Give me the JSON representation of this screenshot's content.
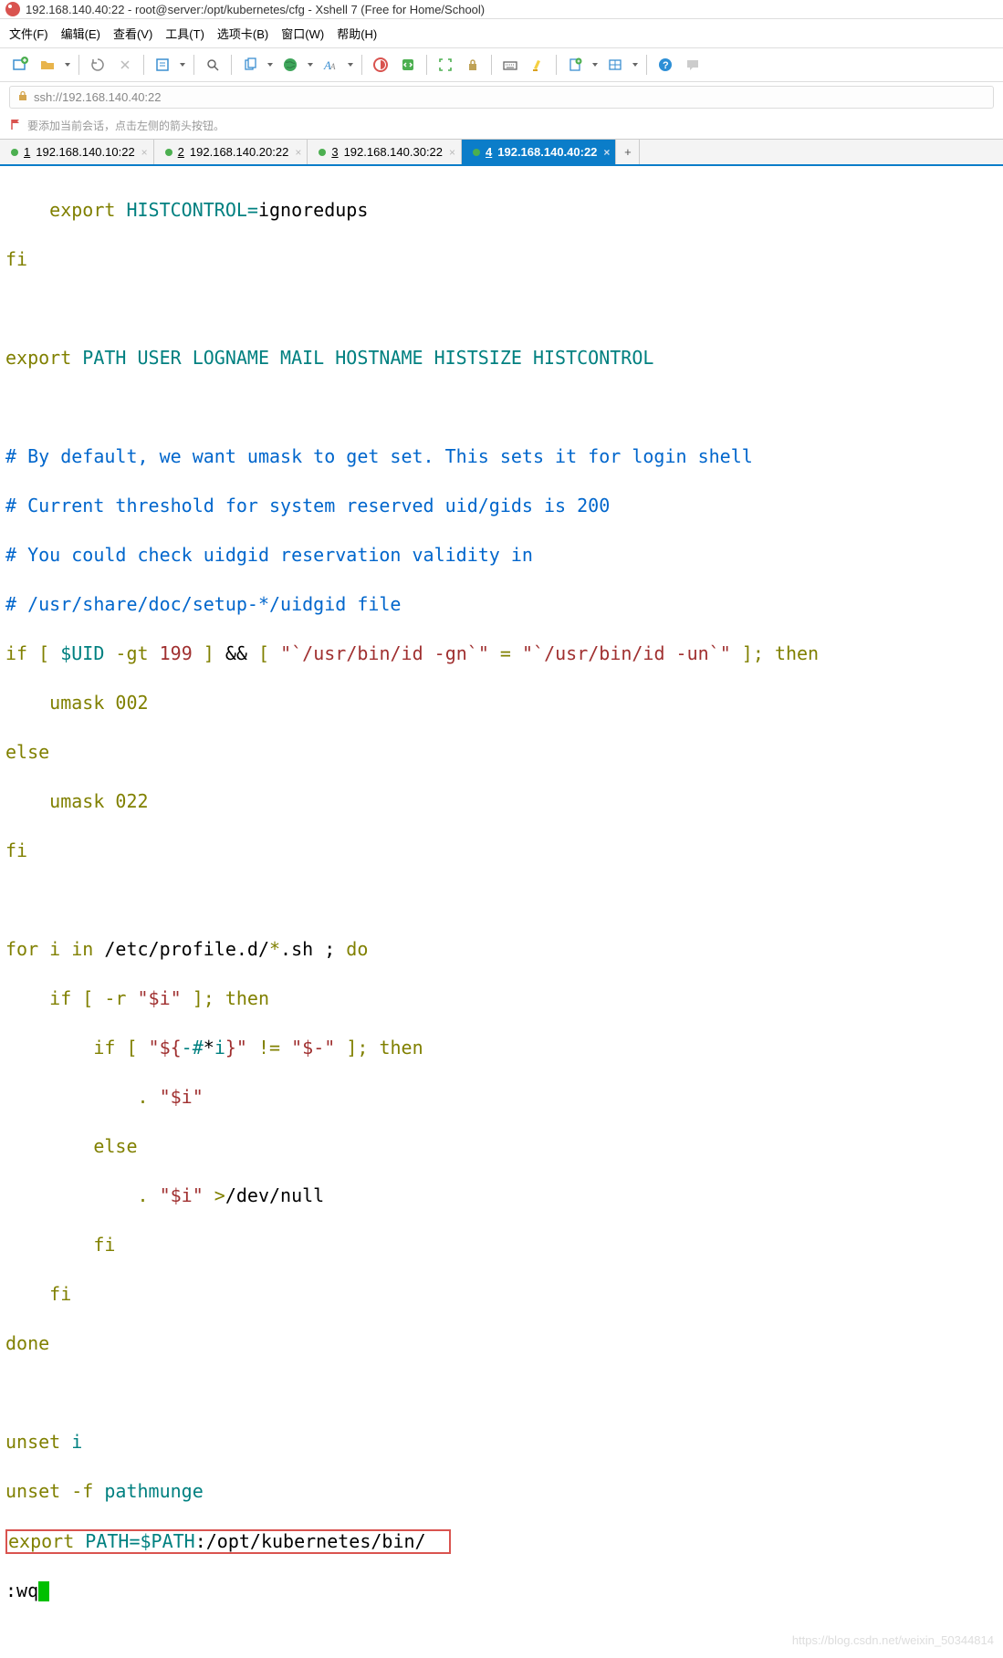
{
  "title": "192.168.140.40:22 - root@server:/opt/kubernetes/cfg - Xshell 7 (Free for Home/School)",
  "menu": {
    "file": "文件(F)",
    "edit": "编辑(E)",
    "view": "查看(V)",
    "tools": "工具(T)",
    "tab": "选项卡(B)",
    "window": "窗口(W)",
    "help": "帮助(H)"
  },
  "address": "ssh://192.168.140.40:22",
  "info_hint": "要添加当前会话，点击左侧的箭头按钮。",
  "tabs": [
    {
      "num": "1",
      "label": "192.168.140.10:22",
      "active": false
    },
    {
      "num": "2",
      "label": "192.168.140.20:22",
      "active": false
    },
    {
      "num": "3",
      "label": "192.168.140.30:22",
      "active": false
    },
    {
      "num": "4",
      "label": "192.168.140.40:22",
      "active": true
    }
  ],
  "term": {
    "l1a": "    export",
    "l1b": " HISTCONTROL=",
    "l1c": "ignoredups",
    "l2": "fi",
    "l4a": "export",
    "l4b": " PATH USER LOGNAME MAIL HOSTNAME HISTSIZE HISTCONTROL",
    "l6": "# By default, we want umask to get set. This sets it for login shell",
    "l7": "# Current threshold for system reserved uid/gids is 200",
    "l8": "# You could check uidgid reservation validity in",
    "l9": "# /usr/share/doc/setup-*/uidgid file",
    "l10a": "if",
    "l10b": " [ ",
    "l10c": "$UID",
    "l10d": " -gt ",
    "l10e": "199",
    "l10f": " ] ",
    "l10g": "&&",
    "l10h": " [ ",
    "l10i": "\"`/usr/bin/id -gn`\"",
    "l10j": " = ",
    "l10k": "\"`/usr/bin/id -un`\"",
    "l10l": " ]; ",
    "l10m": "then",
    "l11": "    umask 002",
    "l12": "else",
    "l13": "    umask 022",
    "l14": "fi",
    "l16a": "for",
    "l16b": " i ",
    "l16c": "in",
    "l16d": " /etc/profile.d/",
    "l16e": "*",
    "l16f": ".sh ; ",
    "l16g": "do",
    "l17a": "    if",
    "l17b": " [ -r ",
    "l17c": "\"$i\"",
    "l17d": " ]; ",
    "l17e": "then",
    "l18a": "        if",
    "l18b": " [ ",
    "l18c": "\"${",
    "l18d": "-#",
    "l18e": "*",
    "l18f": "i",
    "l18g": "}\"",
    "l18h": " != ",
    "l18i": "\"$-\"",
    "l18j": " ]; ",
    "l18k": "then",
    "l19a": "            . ",
    "l19b": "\"$i\"",
    "l20": "        else",
    "l21a": "            . ",
    "l21b": "\"$i\"",
    "l21c": " >",
    "l21d": "/dev/null",
    "l22": "        fi",
    "l23": "    fi",
    "l24": "done",
    "l26a": "unset",
    "l26b": " i",
    "l27a": "unset",
    "l27b": " -f ",
    "l27c": "pathmunge",
    "l28a": "export",
    "l28b": " PATH=",
    "l28c": "$PATH",
    "l28d": ":/opt/kubernetes/bin/  ",
    "l29": ":wq"
  },
  "watermark": "https://blog.csdn.net/weixin_50344814"
}
